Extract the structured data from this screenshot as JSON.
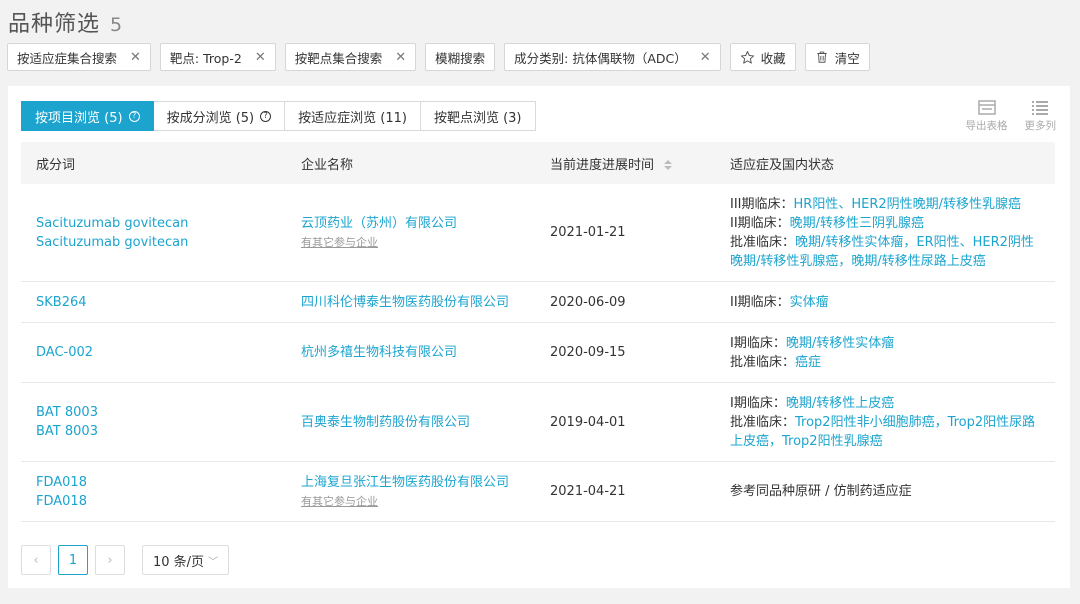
{
  "header": {
    "title": "品种筛选",
    "count": "5"
  },
  "filters": [
    {
      "label": "按适应症集合搜索",
      "closable": true
    },
    {
      "label": "靶点: Trop-2",
      "closable": true
    },
    {
      "label": "按靶点集合搜索",
      "closable": true
    },
    {
      "label": "模糊搜索",
      "closable": false
    },
    {
      "label": "成分类别: 抗体偶联物（ADC）",
      "closable": true
    }
  ],
  "actions": {
    "favorite": "收藏",
    "clear": "清空"
  },
  "tabs": [
    {
      "label": "按项目浏览 (5)",
      "help": true,
      "active": true
    },
    {
      "label": "按成分浏览 (5)",
      "help": true,
      "active": false
    },
    {
      "label": "按适应症浏览 (11)",
      "help": false,
      "active": false
    },
    {
      "label": "按靶点浏览 (3)",
      "help": false,
      "active": false
    }
  ],
  "tools": {
    "export": "导出表格",
    "more_columns": "更多列"
  },
  "columns": {
    "c1": "成分词",
    "c2": "企业名称",
    "c3": "当前进度进展时间",
    "c4": "适应症及国内状态"
  },
  "rows": [
    {
      "names": [
        "Sacituzumab govitecan",
        "Sacituzumab govitecan"
      ],
      "company": "云顶药业（苏州）有限公司",
      "other": "有其它参与企业",
      "date": "2021-01-21",
      "status": [
        {
          "label": "III期临床：",
          "text": "HR阳性、HER2阴性晚期/转移性乳腺癌"
        },
        {
          "label": "II期临床：",
          "text": "晚期/转移性三阴乳腺癌"
        },
        {
          "label": "批准临床：",
          "text": "晚期/转移性实体瘤，ER阳性、HER2阴性晚期/转移性乳腺癌，晚期/转移性尿路上皮癌"
        }
      ]
    },
    {
      "names": [
        "SKB264"
      ],
      "company": "四川科伦博泰生物医药股份有限公司",
      "other": "",
      "date": "2020-06-09",
      "status": [
        {
          "label": "II期临床：",
          "text": "实体瘤"
        }
      ]
    },
    {
      "names": [
        "DAC-002"
      ],
      "company": "杭州多禧生物科技有限公司",
      "other": "",
      "date": "2020-09-15",
      "status": [
        {
          "label": "I期临床：",
          "text": "晚期/转移性实体瘤"
        },
        {
          "label": "批准临床：",
          "text": "癌症"
        }
      ]
    },
    {
      "names": [
        "BAT 8003",
        "BAT 8003"
      ],
      "company": "百奥泰生物制药股份有限公司",
      "other": "",
      "date": "2019-04-01",
      "status": [
        {
          "label": "I期临床：",
          "text": "晚期/转移性上皮癌"
        },
        {
          "label": "批准临床：",
          "text": "Trop2阳性非小细胞肺癌，Trop2阳性尿路上皮癌，Trop2阳性乳腺癌"
        }
      ]
    },
    {
      "names": [
        "FDA018",
        "FDA018"
      ],
      "company": "上海复旦张江生物医药股份有限公司",
      "other": "有其它参与企业",
      "date": "2021-04-21",
      "status": [
        {
          "label": "",
          "text": "参考同品种原研 / 仿制药适应症",
          "plain": true
        }
      ]
    }
  ],
  "pager": {
    "prev": "‹",
    "current": "1",
    "next": "›",
    "page_size": "10 条/页"
  },
  "colors": {
    "accent": "#1ca4cf",
    "background": "#f2f2f2"
  }
}
